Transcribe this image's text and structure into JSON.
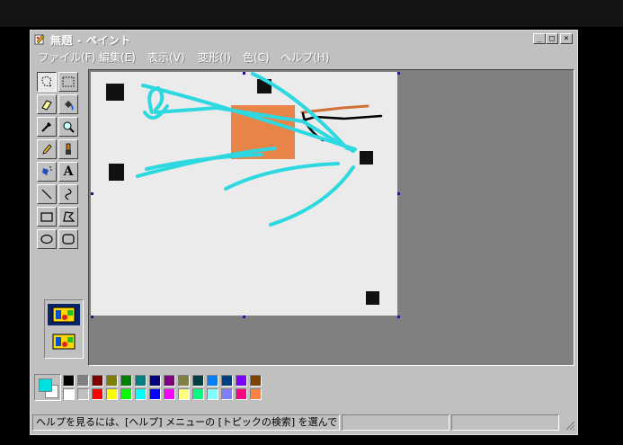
{
  "window": {
    "title": "無題 - ペイント",
    "controls": {
      "minimize": "_",
      "maximize": "□",
      "close": "×"
    }
  },
  "menubar": {
    "items": [
      "ファイル(F)",
      "編集(E)",
      "表示(V)",
      "変形(I)",
      "色(C)",
      "ヘルプ(H)"
    ]
  },
  "toolbox": {
    "tools": [
      {
        "name": "free-select",
        "icon": "free-select-icon"
      },
      {
        "name": "rect-select",
        "icon": "rect-select-icon"
      },
      {
        "name": "eraser",
        "icon": "eraser-icon"
      },
      {
        "name": "fill",
        "icon": "paint-bucket-icon"
      },
      {
        "name": "color-picker",
        "icon": "eyedropper-icon"
      },
      {
        "name": "magnifier",
        "icon": "magnifier-icon"
      },
      {
        "name": "pencil",
        "icon": "pencil-icon"
      },
      {
        "name": "brush",
        "icon": "brush-icon"
      },
      {
        "name": "airbrush",
        "icon": "airbrush-icon"
      },
      {
        "name": "text",
        "icon": "text-icon",
        "glyph": "A"
      },
      {
        "name": "line",
        "icon": "line-icon"
      },
      {
        "name": "curve",
        "icon": "curve-icon"
      },
      {
        "name": "rectangle",
        "icon": "rectangle-icon"
      },
      {
        "name": "polygon",
        "icon": "polygon-icon"
      },
      {
        "name": "ellipse",
        "icon": "ellipse-icon"
      },
      {
        "name": "rounded-rect",
        "icon": "rounded-rect-icon"
      }
    ],
    "selected": "free-select"
  },
  "palette": {
    "foreground": "#00e0e0",
    "background": "#ffffff",
    "top_row": [
      "#000000",
      "#808080",
      "#800000",
      "#808000",
      "#008000",
      "#008080",
      "#000080",
      "#800080",
      "#808040",
      "#004040",
      "#0080ff",
      "#004080",
      "#8000ff",
      "#804000"
    ],
    "bottom_row": [
      "#ffffff",
      "#c0c0c0",
      "#ff0000",
      "#ffff00",
      "#00ff00",
      "#00ffff",
      "#0000ff",
      "#ff00ff",
      "#ffff80",
      "#00ff80",
      "#80ffff",
      "#8080ff",
      "#ff0080",
      "#ff8040"
    ]
  },
  "statusbar": {
    "help_text": "ヘルプを見るには、[ヘルプ] メニューの [トピックの検索] を選んでください。",
    "coords": "",
    "size": ""
  },
  "colors": {
    "face": "#c0c0c0",
    "workspace": "#808080",
    "canvas": "#ebebeb",
    "cyan_stroke": "#2ed8e0",
    "orange_rect": "#e88448",
    "orange_stroke": "#d07038"
  }
}
